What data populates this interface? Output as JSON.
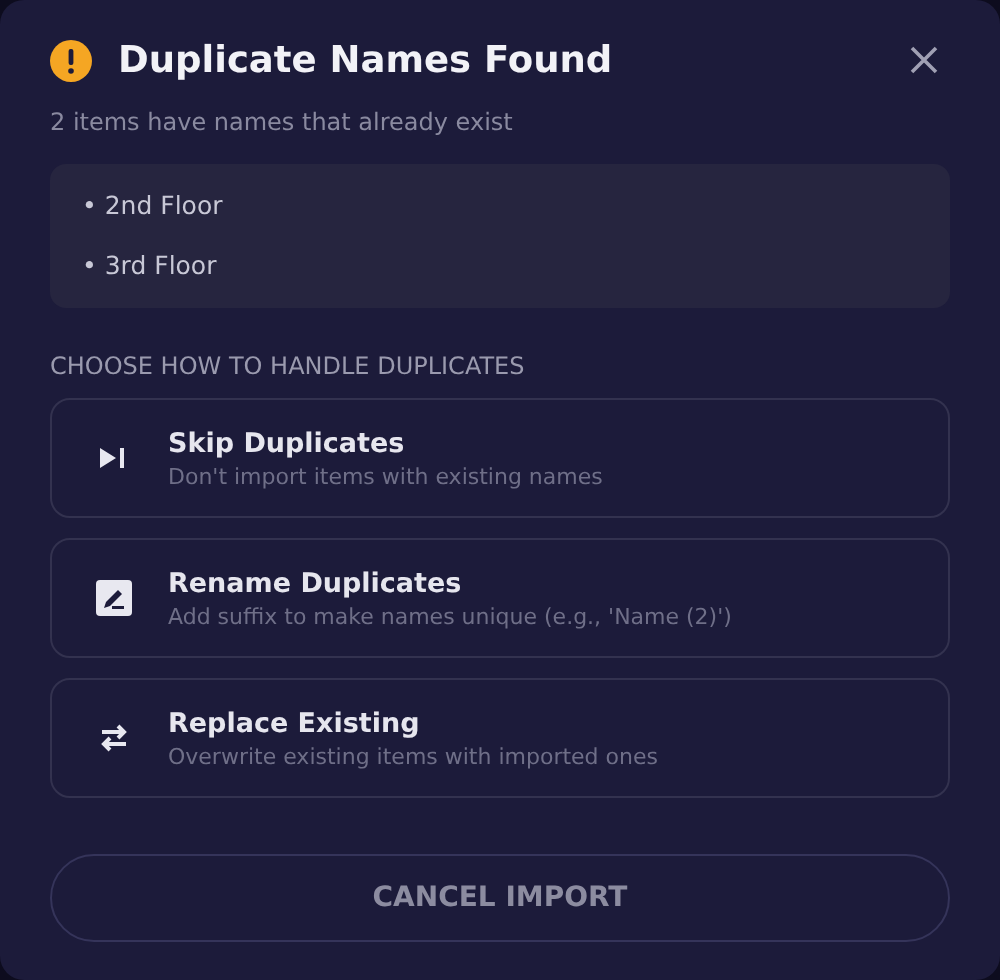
{
  "dialog": {
    "title": "Duplicate Names Found",
    "subtitle": "2 items have names that already exist"
  },
  "duplicates": [
    "• 2nd Floor",
    "• 3rd Floor"
  ],
  "section_label": "CHOOSE HOW TO HANDLE DUPLICATES",
  "options": [
    {
      "kind": "skip",
      "title": "Skip Duplicates",
      "description": "Don't import items with existing names"
    },
    {
      "kind": "rename",
      "title": "Rename Duplicates",
      "description": "Add suffix to make names unique (e.g., 'Name (2)')"
    },
    {
      "kind": "replace",
      "title": "Replace Existing",
      "description": "Overwrite existing items with imported ones"
    }
  ],
  "cancel_button": "CANCEL IMPORT"
}
